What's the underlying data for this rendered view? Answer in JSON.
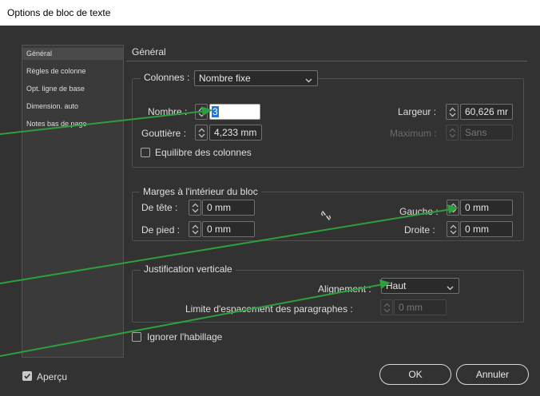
{
  "window": {
    "title": "Options de bloc de texte"
  },
  "sidebar": {
    "items": [
      {
        "label": "Général"
      },
      {
        "label": "Règles de colonne"
      },
      {
        "label": "Opt. ligne de base"
      },
      {
        "label": "Dimension. auto"
      },
      {
        "label": "Notes bas de page"
      }
    ]
  },
  "main": {
    "title": "Général",
    "columns": {
      "label": "Colonnes :",
      "type_value": "Nombre fixe",
      "number_label": "Nombre :",
      "number_value": "3",
      "width_label": "Largeur :",
      "width_value": "60,626 mr",
      "gutter_label": "Gouttière :",
      "gutter_value": "4,233 mm",
      "max_label": "Maximum :",
      "max_value": "Sans",
      "balance_label": "Equilibre des colonnes",
      "balance_checked": false
    },
    "inset": {
      "title": "Marges à l'intérieur du bloc",
      "top_label": "De tête :",
      "top_value": "0 mm",
      "bottom_label": "De pied :",
      "bottom_value": "0 mm",
      "left_label": "Gauche :",
      "left_value": "0 mm",
      "right_label": "Droite :",
      "right_value": "0 mm",
      "link_icon": "chain-link-broken-icon"
    },
    "vertical": {
      "title": "Justification verticale",
      "align_label": "Alignement :",
      "align_value": "Haut",
      "spacing_label": "Limite d'espacement des paragraphes :",
      "spacing_value": "0 mm"
    },
    "ignore_wrap_label": "Ignorer l'habillage",
    "ignore_wrap_checked": false
  },
  "footer": {
    "preview_label": "Aperçu",
    "preview_checked": true,
    "ok_label": "OK",
    "cancel_label": "Annuler"
  },
  "colors": {
    "dialog_bg": "#323232",
    "annotation_arrow": "#2e9e3e",
    "selection": "#1f76d3"
  }
}
